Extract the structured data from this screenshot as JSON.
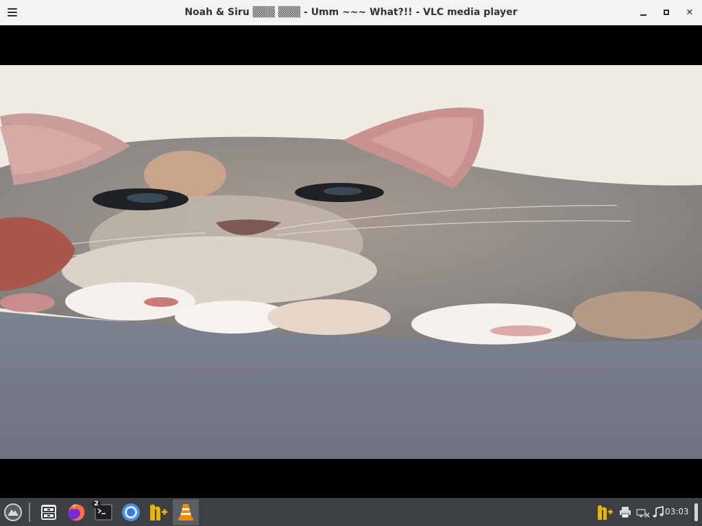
{
  "window": {
    "title": "Noah & Siru ▒▒▒ ▒▒▒ - Umm  ~~~ What?!! - VLC media player",
    "menu_icon": "hamburger-menu-icon",
    "minimize_icon": "minimize-icon",
    "maximize_icon": "maximize-icon",
    "close_icon": "close-icon",
    "close_glyph": "✕"
  },
  "video": {
    "content": "video-frame-kitten"
  },
  "taskbar": {
    "launcher_icon": "launcher-icon",
    "apps": [
      {
        "name": "file-manager-icon",
        "active": false
      },
      {
        "name": "firefox-icon",
        "active": false
      },
      {
        "name": "terminal-icon",
        "active": false,
        "badge": "2"
      },
      {
        "name": "chromium-icon",
        "active": false
      },
      {
        "name": "notepadqq-icon",
        "active": false
      },
      {
        "name": "vlc-icon",
        "active": true
      }
    ],
    "tray": [
      "notepadqq-tray-icon",
      "printer-icon",
      "network-disconnected-icon",
      "music-icon"
    ],
    "clock": "03:03"
  },
  "colors": {
    "titlebar_bg": "#f3f3f3",
    "taskbar_bg": "#3c3f44",
    "taskbar_active": "#5a5e66",
    "vlc_orange": "#f08a00",
    "firefox_orange": "#ff7139",
    "chromium_blue": "#4a90e2",
    "notepadqq_yellow": "#e8b400"
  }
}
